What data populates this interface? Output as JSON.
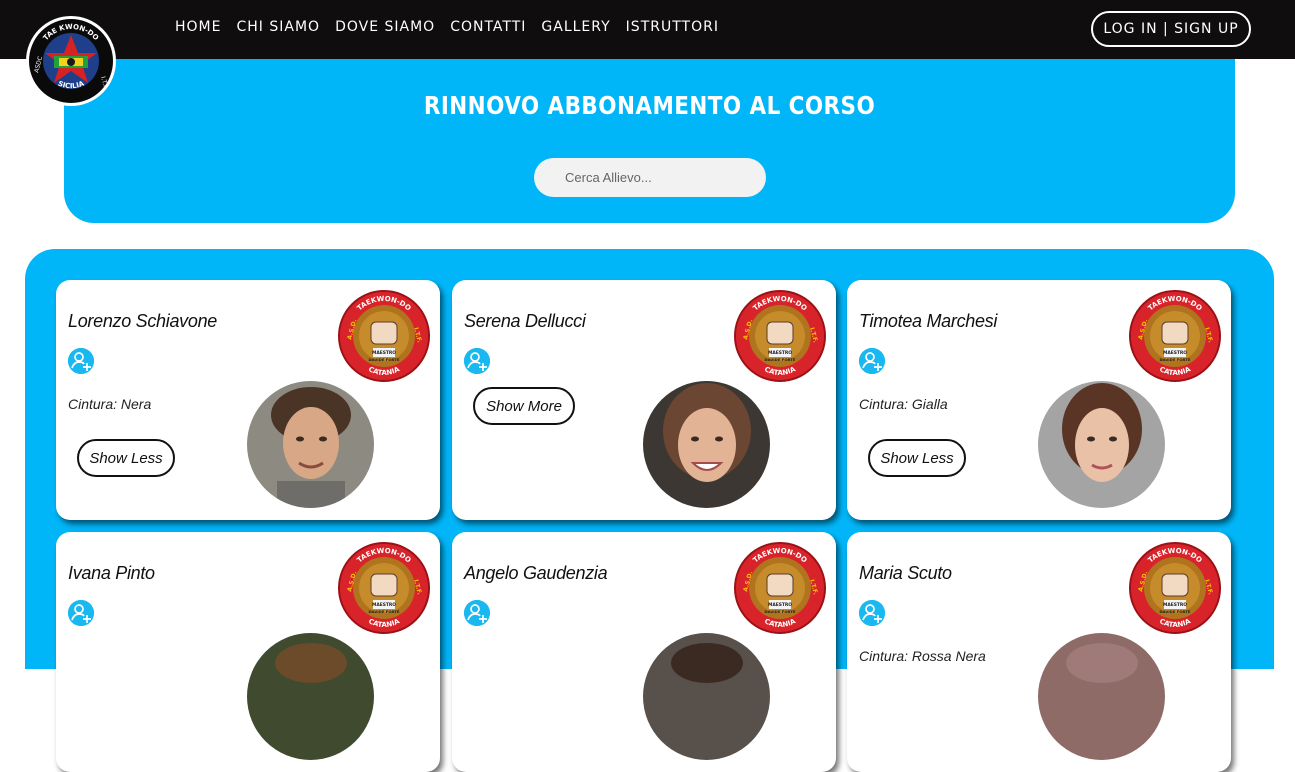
{
  "nav": {
    "links": [
      "HOME",
      "CHI SIAMO",
      "DOVE SIAMO",
      "CONTATTI",
      "GALLERY",
      "ISTRUTTORI"
    ],
    "login_label": "LOG IN | SIGN UP"
  },
  "logo": {
    "top_text": "TAE KWON-DO",
    "left_text": "ASDC",
    "right_text": "I.T.F.",
    "bottom_text": "SICILIA"
  },
  "hero": {
    "title": "RINNOVO ABBONAMENTO AL CORSO",
    "search_placeholder": "Cerca Allievo..."
  },
  "badge": {
    "top_text": "TAEKWON-DO",
    "left_text": "A.S.D.",
    "right_text": "I.T.F.",
    "line1": "MAESTRO",
    "line2": "DAVIDE FORTE",
    "bottom_text": "CATANIA"
  },
  "colors": {
    "accent": "#00b6f9",
    "nav_bg": "#0f0d0d",
    "badge_red": "#d9232a"
  },
  "cards": [
    {
      "name": "Lorenzo Schiavone",
      "belt": "Cintura: Nera",
      "button": "Show Less"
    },
    {
      "name": "Serena Dellucci",
      "belt": "",
      "button": "Show More"
    },
    {
      "name": "Timotea Marchesi",
      "belt": "Cintura: Gialla",
      "button": "Show Less"
    },
    {
      "name": "Ivana Pinto",
      "belt": "",
      "button": ""
    },
    {
      "name": "Angelo Gaudenzia",
      "belt": "",
      "button": ""
    },
    {
      "name": "Maria Scuto",
      "belt": "Cintura: Rossa Nera",
      "button": ""
    }
  ]
}
